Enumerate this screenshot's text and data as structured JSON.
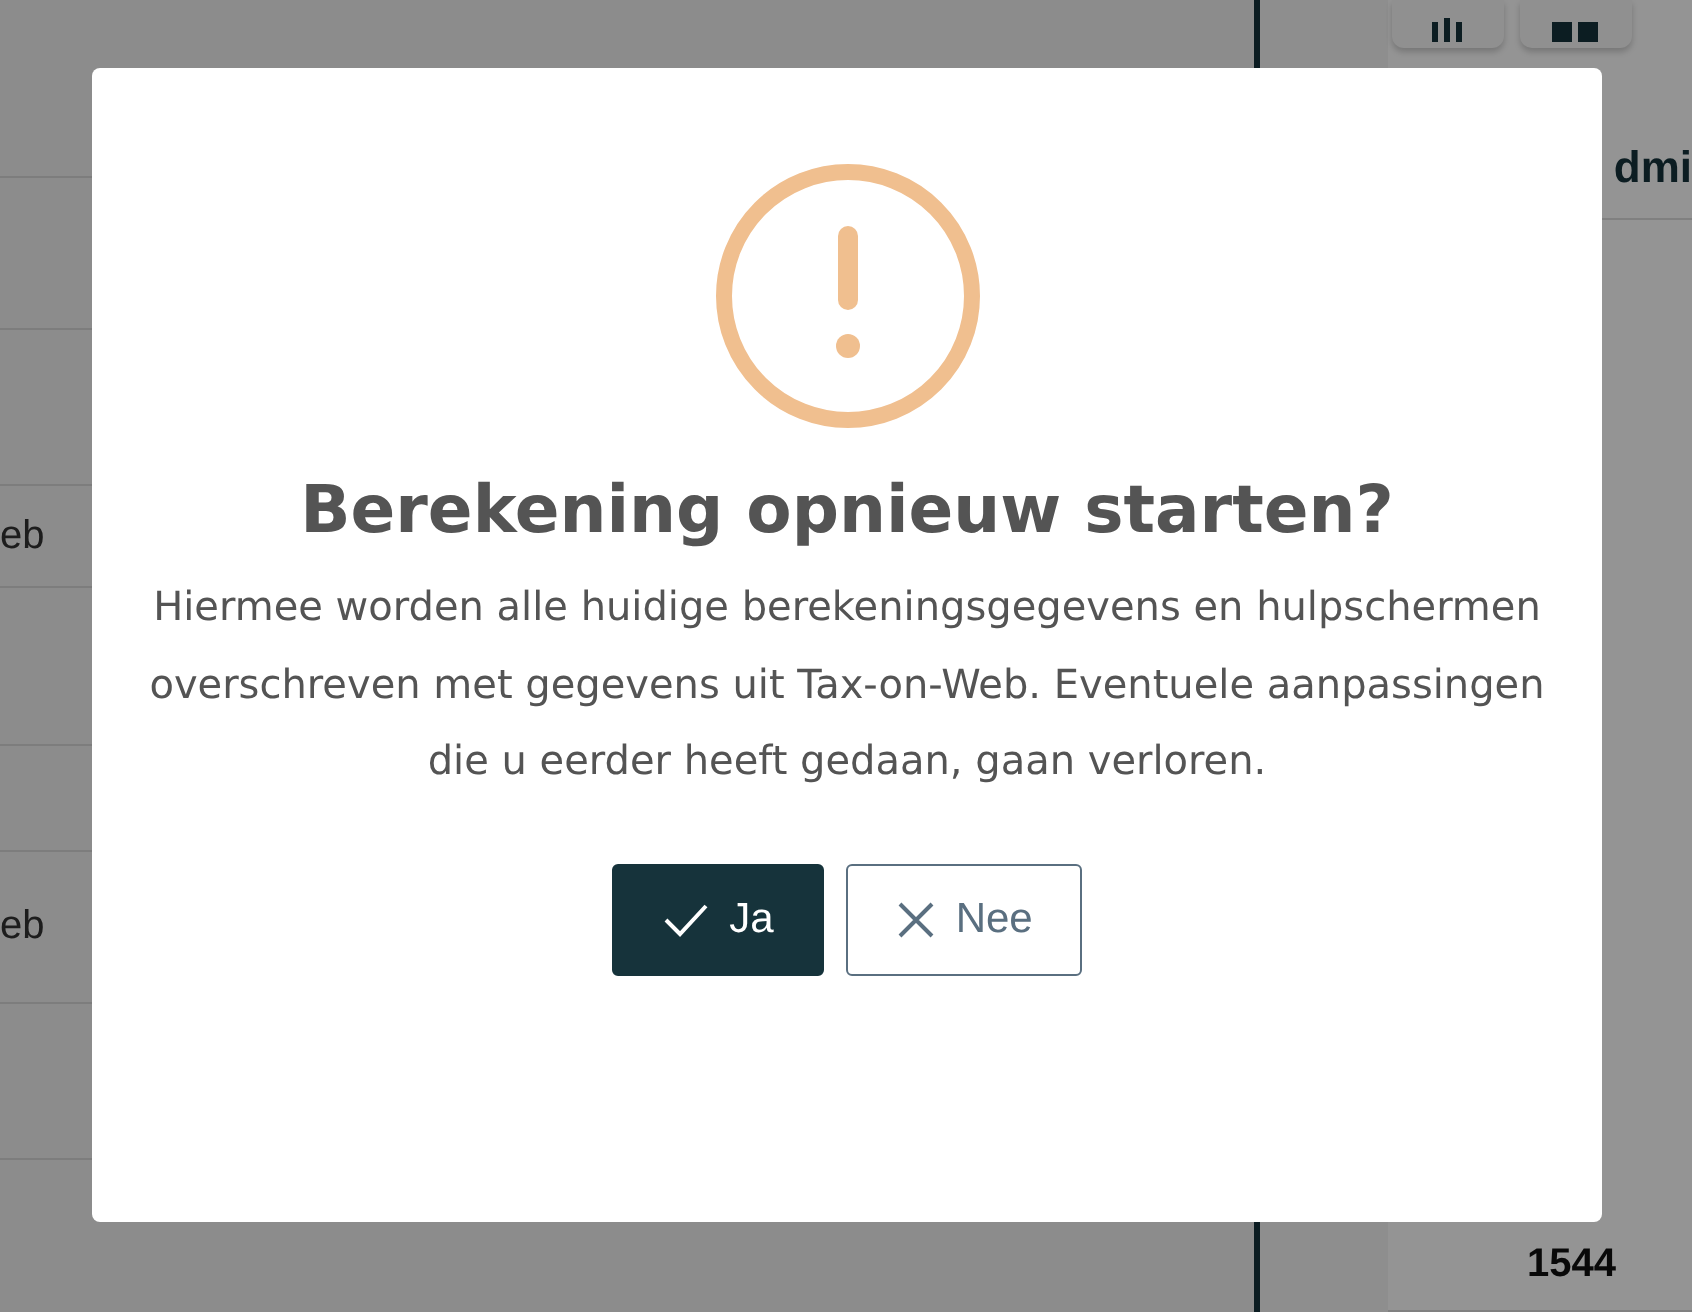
{
  "background": {
    "left_rows": [
      {
        "text": ""
      },
      {
        "text": ""
      },
      {
        "text": ""
      },
      {
        "text": "eb"
      },
      {
        "text": ""
      },
      {
        "text": ""
      },
      {
        "text": "eb"
      },
      {
        "text": ""
      }
    ],
    "right_column": {
      "header": "dmi",
      "total": "1544"
    }
  },
  "dialog": {
    "title": "Berekening opnieuw starten?",
    "message": "Hiermee worden alle huidige berekeningsgegevens en hulpschermen overschreven met gegevens uit Tax-on-Web. Eventuele aanpassingen die u eerder heeft gedaan, gaan verloren.",
    "buttons": [
      {
        "label": "Ja",
        "kind": "confirm"
      },
      {
        "label": "Nee",
        "kind": "cancel"
      }
    ]
  }
}
